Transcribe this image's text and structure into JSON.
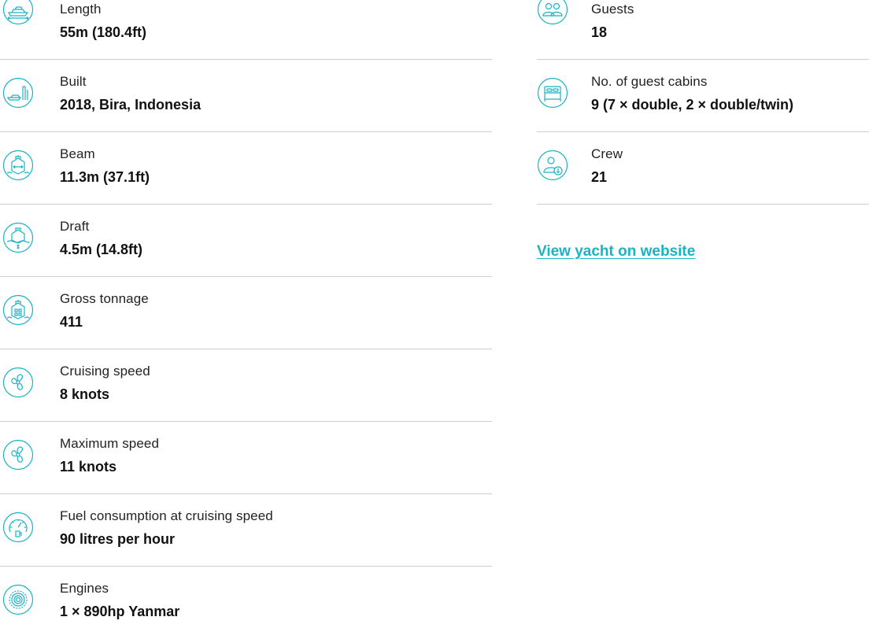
{
  "accent_color": "#1ab3c4",
  "left_specs": [
    {
      "icon": "yacht-length-icon",
      "label": "Length",
      "value": "55m (180.4ft)"
    },
    {
      "icon": "shipyard-built-icon",
      "label": "Built",
      "value": "2018, Bira, Indonesia"
    },
    {
      "icon": "ship-beam-icon",
      "label": "Beam",
      "value": "11.3m (37.1ft)"
    },
    {
      "icon": "ship-draft-icon",
      "label": "Draft",
      "value": "4.5m (14.8ft)"
    },
    {
      "icon": "gross-tonnage-icon",
      "label": "Gross tonnage",
      "value": "411"
    },
    {
      "icon": "propeller-icon",
      "label": "Cruising speed",
      "value": "8 knots"
    },
    {
      "icon": "propeller-icon",
      "label": "Maximum speed",
      "value": "11 knots"
    },
    {
      "icon": "fuel-gauge-icon",
      "label": "Fuel consumption at cruising speed",
      "value": "90 litres per hour"
    },
    {
      "icon": "engine-gear-icon",
      "label": "Engines",
      "value": "1 × 890hp Yanmar"
    }
  ],
  "right_specs": [
    {
      "icon": "guests-icon",
      "label": "Guests",
      "value": "18"
    },
    {
      "icon": "bed-cabin-icon",
      "label": "No. of guest cabins",
      "value": "9 (7 × double, 2 × double/twin)"
    },
    {
      "icon": "crew-anchor-icon",
      "label": "Crew",
      "value": "21"
    }
  ],
  "link": {
    "label": "View yacht on website"
  }
}
